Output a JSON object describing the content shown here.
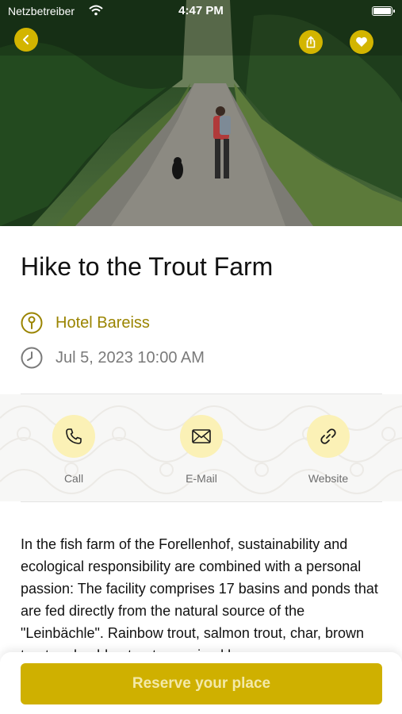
{
  "status_bar": {
    "carrier": "Netzbetreiber",
    "time": "4:47 PM"
  },
  "hero": {
    "image": "forest-road-hike-photo",
    "buttons": {
      "back_icon": "chevron-left-icon",
      "share_icon": "share-icon",
      "favorite_icon": "heart-icon"
    }
  },
  "event": {
    "title": "Hike to the Trout Farm",
    "location": "Hotel Bareiss",
    "datetime": "Jul 5, 2023 10:00 AM"
  },
  "contact": [
    {
      "label": "Call",
      "icon": "phone-icon"
    },
    {
      "label": "E-Mail",
      "icon": "envelope-icon"
    },
    {
      "label": "Website",
      "icon": "link-icon"
    }
  ],
  "description": "In the fish farm of the Forellenhof, sustainability and ecological responsibility are combined with a personal passion: The facility comprises 17 basins and ponds that are fed directly from the natural source of the \"Leinbächle\". Rainbow trout, salmon trout, char, brown trout and golden trout are raised here.",
  "cta": {
    "label": "Reserve your place"
  },
  "colors": {
    "accent": "#d3b500",
    "accent_text": "#9a8400",
    "contact_circle": "#fbf1b6",
    "button_text": "#f3e9a8"
  }
}
